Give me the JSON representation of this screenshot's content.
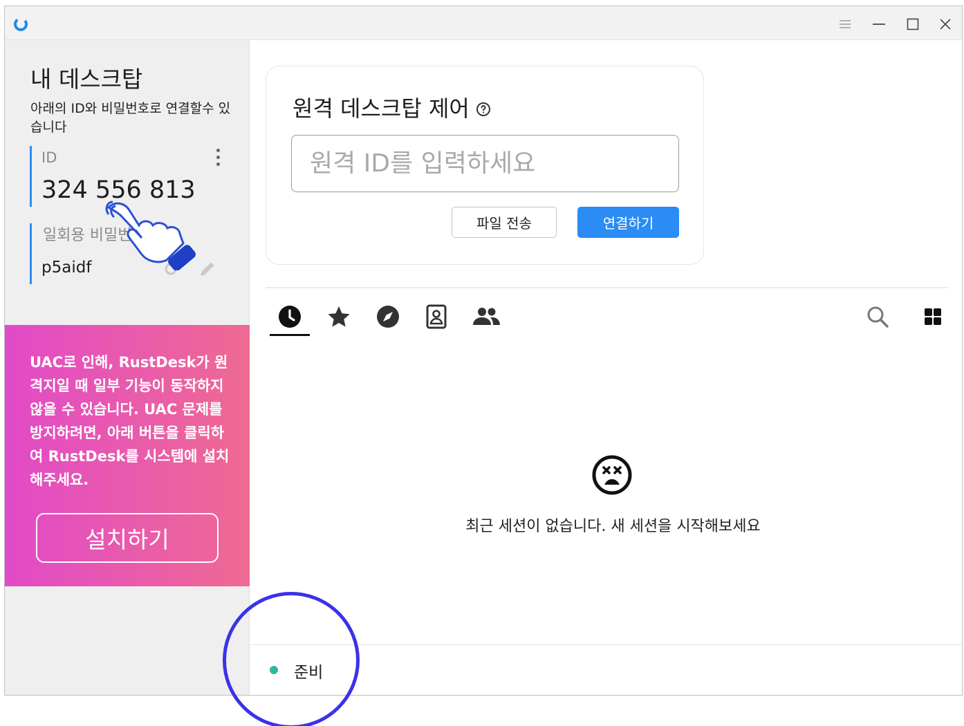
{
  "window": {
    "controls": [
      "menu-icon",
      "minimize-icon",
      "maximize-icon",
      "close-icon"
    ]
  },
  "sidebar": {
    "title": "내 데스크탑",
    "description": "아래의 ID와 비밀번호로 연결할수 있습니다",
    "id_label": "ID",
    "id_value": "324 556 813",
    "password_label": "일회용 비밀번호",
    "password_value": "p5aidf",
    "uac_warning": "UAC로 인해, RustDesk가 원격지일 때 일부 기능이 동작하지 않을 수 있습니다. UAC 문제를 방지하려면, 아래 버튼을 클릭하여 RustDesk를 시스템에 설치해주세요.",
    "install_label": "설치하기"
  },
  "connect": {
    "title": "원격 데스크탑 제어",
    "placeholder": "원격 ID를 입력하세요",
    "value": "",
    "file_transfer_label": "파일 전송",
    "connect_label": "연결하기"
  },
  "tabs": [
    {
      "name": "recent-sessions",
      "icon": "clock-icon",
      "active": true
    },
    {
      "name": "favorites",
      "icon": "star-icon",
      "active": false
    },
    {
      "name": "discovered",
      "icon": "compass-icon",
      "active": false
    },
    {
      "name": "address-book",
      "icon": "contact-icon",
      "active": false
    },
    {
      "name": "group",
      "icon": "people-icon",
      "active": false
    }
  ],
  "session_list": {
    "empty_icon": "sad-face-icon",
    "empty_message": "최근 세션이 없습니다. 새 세션을 시작해보세요"
  },
  "status": {
    "label": "준비",
    "color": "#2eb6a1"
  },
  "colors": {
    "accent": "#2a8cf4",
    "uac_gradient_start": "#e24ac8",
    "uac_gradient_end": "#ef6a92",
    "overlay_ring": "#3a32e8"
  }
}
